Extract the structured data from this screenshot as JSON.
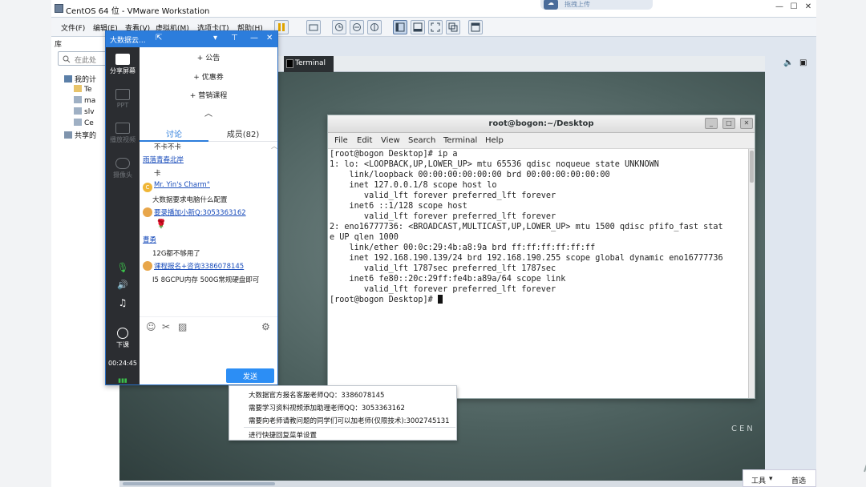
{
  "vmware": {
    "title": "CentOS 64 位 - VMware Workstation",
    "upload_label": "拖拽上传",
    "menus": [
      "文件(F)",
      "编辑(E)",
      "查看(V)",
      "虚拟机(M)",
      "选项卡(T)",
      "帮助(H)"
    ],
    "library_header": "库",
    "search_placeholder": "在此处",
    "tree": [
      "我的计",
      "Te",
      "ma",
      "slv",
      "Ce",
      "共享的"
    ],
    "vm_tab": "Terminal",
    "centos_text": "CEN",
    "tools_label": "工具",
    "preferences_label": "首选"
  },
  "terminal": {
    "title": "root@bogon:~/Desktop",
    "menu": [
      "File",
      "Edit",
      "View",
      "Search",
      "Terminal",
      "Help"
    ],
    "lines": [
      "[root@bogon Desktop]# ip a",
      "1: lo: <LOOPBACK,UP,LOWER_UP> mtu 65536 qdisc noqueue state UNKNOWN",
      "    link/loopback 00:00:00:00:00:00 brd 00:00:00:00:00:00",
      "    inet 127.0.0.1/8 scope host lo",
      "       valid_lft forever preferred_lft forever",
      "    inet6 ::1/128 scope host",
      "       valid_lft forever preferred_lft forever",
      "2: eno16777736: <BROADCAST,MULTICAST,UP,LOWER_UP> mtu 1500 qdisc pfifo_fast stat",
      "e UP qlen 1000",
      "    link/ether 00:0c:29:4b:a8:9a brd ff:ff:ff:ff:ff:ff",
      "    inet 192.168.190.139/24 brd 192.168.190.255 scope global dynamic eno16777736",
      "       valid_lft 1787sec preferred_lft 1787sec",
      "    inet6 fe80::20c:29ff:fe4b:a89a/64 scope link",
      "       valid_lft forever preferred_lft forever",
      "[root@bogon Desktop]# "
    ]
  },
  "chat": {
    "title": "大数据云...",
    "side": {
      "share_screen": "分享屏幕",
      "ppt": "PPT",
      "play_video": "播放视频",
      "camera": "摄像头",
      "end_class": "下课",
      "timer": "00:24:45"
    },
    "actions": [
      "+ 公告",
      "+ 优惠券",
      "+ 营销课程"
    ],
    "tab_discuss": "讨论",
    "tab_members": "成员(82)",
    "messages": [
      {
        "text": "不卡不卡"
      },
      {
        "name": "雨落青春北岸"
      },
      {
        "text": "卡"
      },
      {
        "name": "Mr. Yin's Charm°",
        "avatar": "C"
      },
      {
        "text": "大数据要求电脑什么配置"
      },
      {
        "name": "要录播加小新Q:3053363162"
      },
      {
        "text": "🌹"
      },
      {
        "name": "曹勇"
      },
      {
        "text": "12G都不够用了"
      },
      {
        "name": "课程报名+咨询3386078145"
      },
      {
        "text": "I5 8GCPU内存  500G常规硬盘即可"
      }
    ],
    "send_label": "发送"
  },
  "context_menu": {
    "items": [
      "大数据官方报名客服老师QQ：3386078145",
      "需要学习资料视频添加助理老师QQ：3053363162",
      "需要向老师请教问题的同学们可以加老师(仅限技术):3002745131",
      "进行快捷回复菜单设置"
    ]
  }
}
